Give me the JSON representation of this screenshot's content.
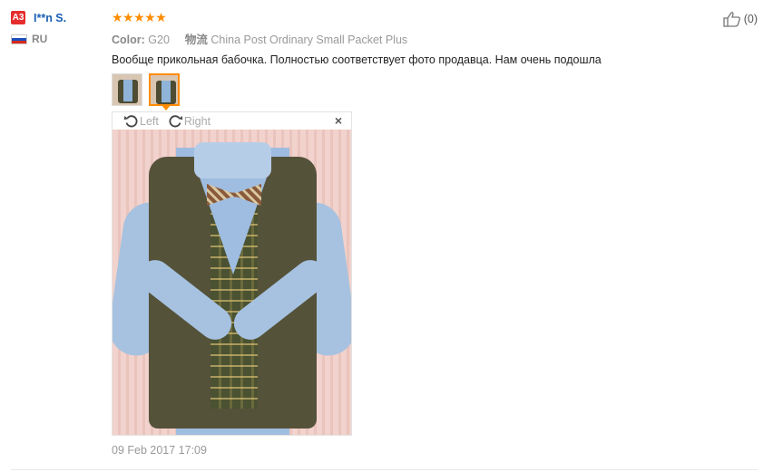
{
  "user": {
    "level_badge": "A3",
    "name": "I**n S.",
    "country": "RU"
  },
  "review": {
    "stars": "★★★★★",
    "color_label": "Color:",
    "color_value": "G20",
    "shipping_label": "物流",
    "shipping_value": "China Post Ordinary Small Packet Plus",
    "text": "Вообще прикольная бабочка. Полностью соответствует фото продавца. Нам очень подошла",
    "date": "09 Feb 2017 17:09"
  },
  "viewer": {
    "rotate_left_label": "Left",
    "rotate_right_label": "Right",
    "close_label": "×"
  },
  "helpful": {
    "count": "(0)"
  },
  "colors": {
    "badge": "#e52d2d",
    "username": "#1a5fb4",
    "stars": "#ff8c00",
    "active_thumb": "#ff8c00"
  },
  "icons": {
    "rotate_left": "rotate-left-icon",
    "rotate_right": "rotate-right-icon",
    "thumbs_up": "thumbs-up-icon",
    "close": "close-icon",
    "flag": "russia-flag-icon"
  }
}
